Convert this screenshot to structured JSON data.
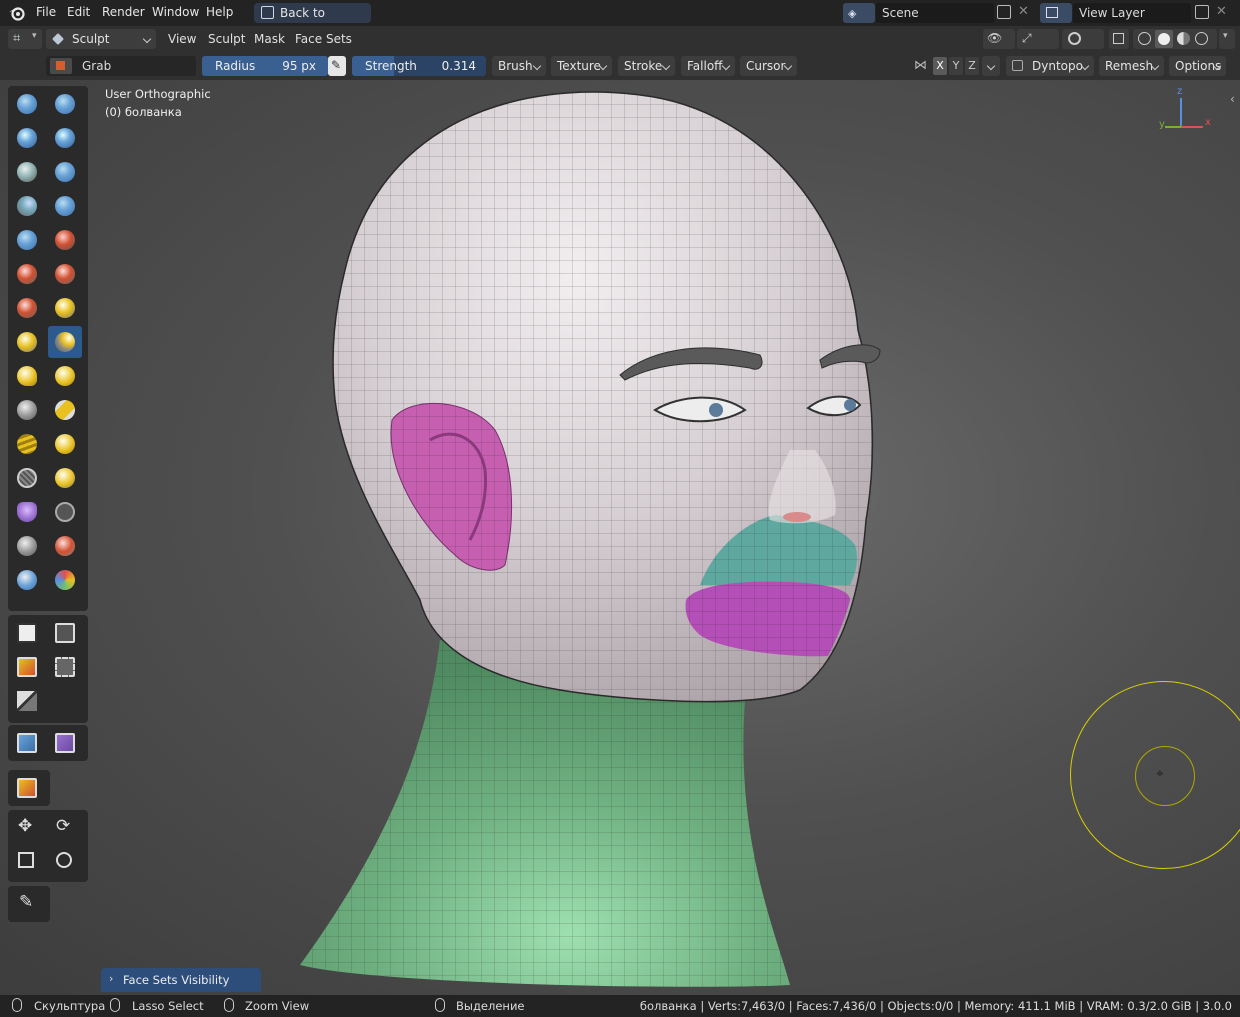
{
  "topbar": {
    "menus": [
      "File",
      "Edit",
      "Render",
      "Window",
      "Help"
    ],
    "back_button": "Back to Previous",
    "scene_label": "Scene",
    "view_layer_label": "View Layer"
  },
  "header": {
    "mode": "Sculpt Mode",
    "menus": [
      "View",
      "Sculpt",
      "Mask",
      "Face Sets"
    ]
  },
  "tool_header": {
    "brush_name": "Grab",
    "radius_label": "Radius",
    "radius_value": "95 px",
    "strength_label": "Strength",
    "strength_value": "0.314",
    "dropdowns": [
      "Brush",
      "Texture",
      "Stroke",
      "Falloff",
      "Cursor"
    ],
    "axes": [
      "X",
      "Y",
      "Z"
    ],
    "dyntopo": "Dyntopo",
    "remesh": "Remesh",
    "options": "Options"
  },
  "viewport": {
    "view_name": "User Orthographic",
    "object_name": "(0) болванка",
    "gizmo_axes": [
      "z",
      "y",
      "x"
    ],
    "last_operator": "Face Sets Visibility"
  },
  "colors": {
    "face_set_pink": "#c65fb0",
    "face_set_teal": "#5fa8a0",
    "face_set_magenta": "#b54fb8",
    "face_set_green": "#6fb080",
    "brush_circle": "#d8d000",
    "active_tool": "#2c5a8c"
  },
  "statusbar": {
    "items": [
      {
        "icon": "mouse-left-icon",
        "label": "Скульптура"
      },
      {
        "icon": "mouse-middle-icon",
        "label": "Lasso Select"
      },
      {
        "icon": "mouse-right-icon",
        "label": "Zoom View"
      },
      {
        "icon": "mouse-right-icon",
        "label": "Выделение"
      }
    ],
    "stats": "болванка | Verts:7,463/0 | Faces:7,436/0 | Objects:0/0 | Memory: 411.1 MiB | VRAM: 0.3/2.0 GiB | 3.0.0"
  }
}
